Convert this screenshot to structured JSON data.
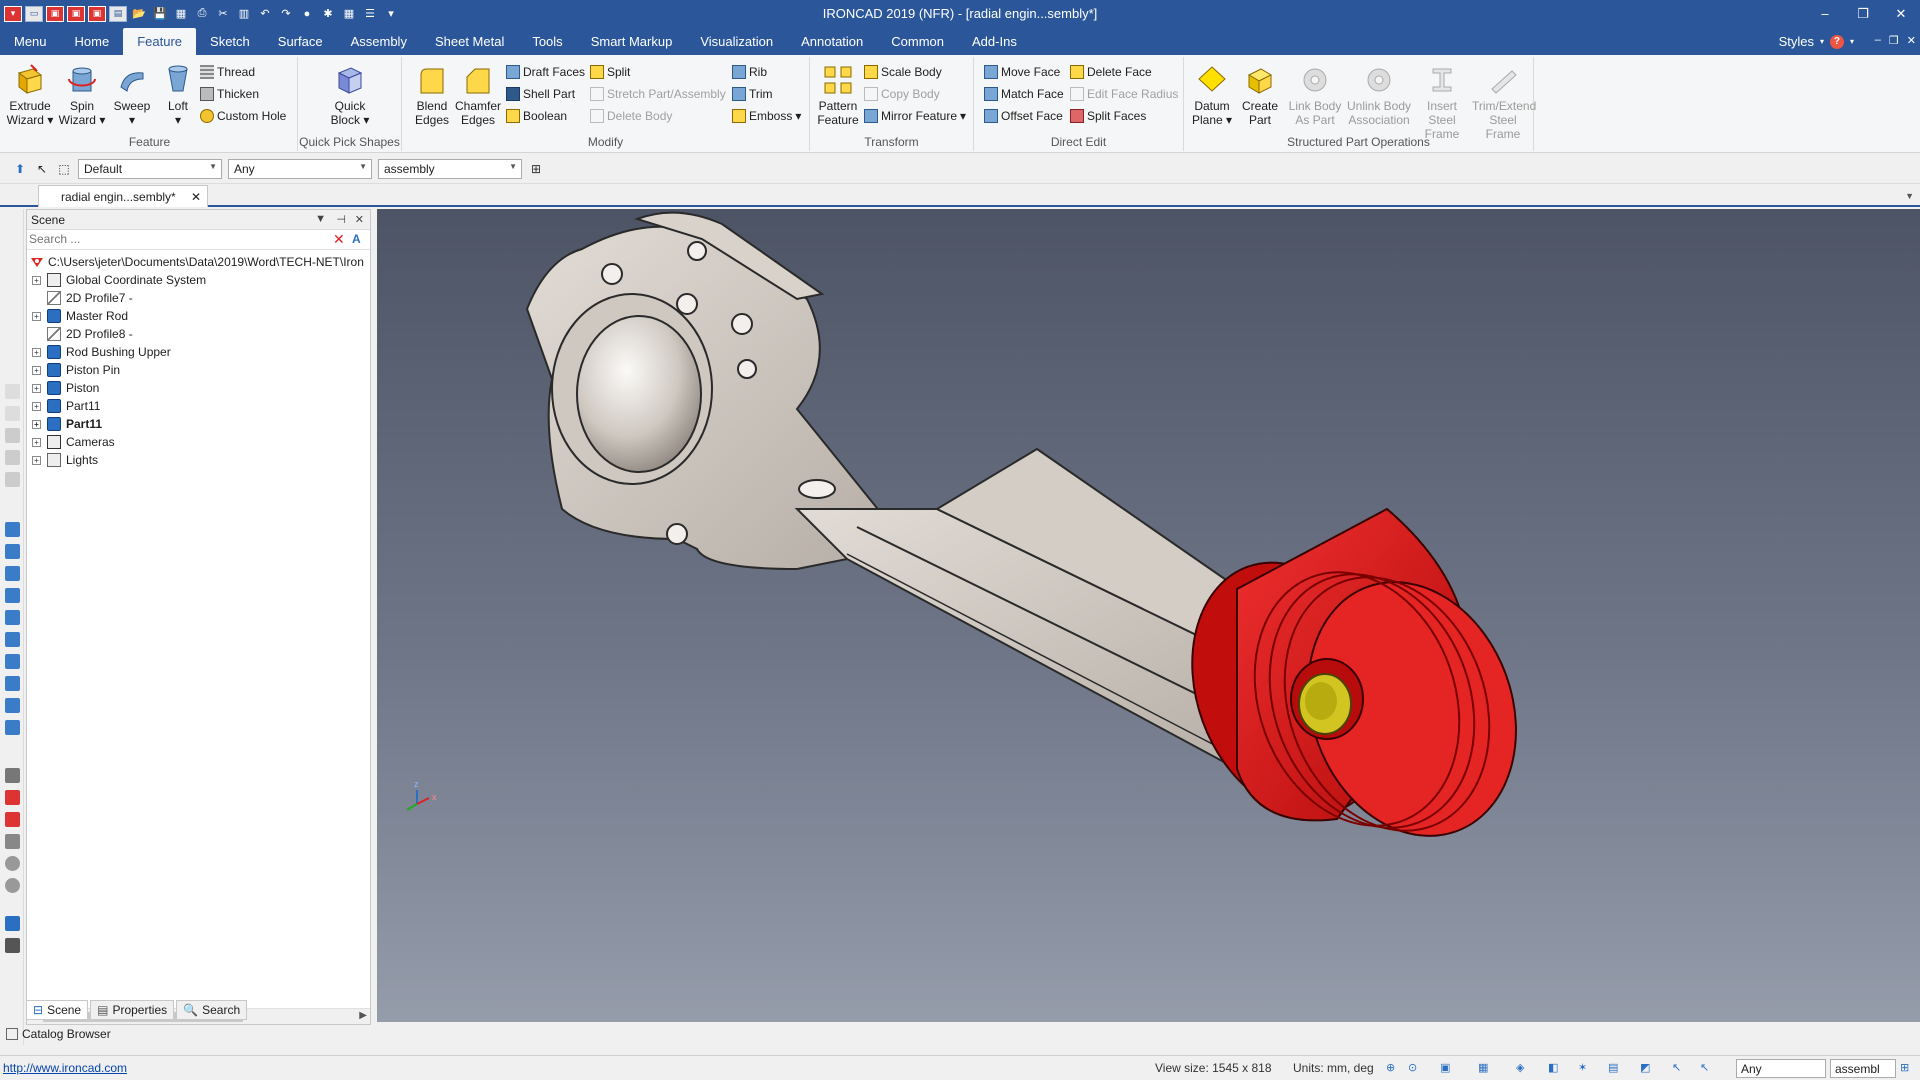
{
  "window": {
    "title": "IRONCAD 2019 (NFR) - [radial engin...sembly*]"
  },
  "ribbon_tabs": [
    "Menu",
    "Home",
    "Feature",
    "Sketch",
    "Surface",
    "Assembly",
    "Sheet Metal",
    "Tools",
    "Smart Markup",
    "Visualization",
    "Annotation",
    "Common",
    "Add-Ins"
  ],
  "active_tab": "Feature",
  "styles_label": "Styles",
  "groups": {
    "feature": {
      "label": "Feature",
      "extrude_wizard": "Extrude Wizard",
      "spin_wizard": "Spin Wizard",
      "sweep": "Sweep",
      "loft": "Loft",
      "thread": "Thread",
      "thicken": "Thicken",
      "custom_hole": "Custom Hole"
    },
    "quick_pick": {
      "label": "Quick Pick Shapes",
      "quick_block": "Quick Block"
    },
    "modify": {
      "label": "Modify",
      "blend_edges": "Blend Edges",
      "chamfer_edges": "Chamfer Edges",
      "draft_faces": "Draft Faces",
      "shell_part": "Shell Part",
      "boolean": "Boolean",
      "split": "Split",
      "stretch": "Stretch Part/Assembly",
      "delete_body": "Delete Body",
      "rib": "Rib",
      "trim": "Trim",
      "emboss": "Emboss"
    },
    "transform": {
      "label": "Transform",
      "pattern_feature": "Pattern Feature",
      "scale_body": "Scale Body",
      "copy_body": "Copy Body",
      "mirror_feature": "Mirror Feature"
    },
    "direct_edit": {
      "label": "Direct Edit",
      "move_face": "Move Face",
      "match_face": "Match Face",
      "offset_face": "Offset Face",
      "delete_face": "Delete Face",
      "edit_face_radius": "Edit Face Radius",
      "split_faces": "Split Faces"
    },
    "structured": {
      "label": "Structured Part Operations",
      "datum_plane": "Datum Plane",
      "create_part": "Create Part",
      "link_body": "Link Body As Part",
      "unlink_body": "Unlink Body Association",
      "insert_steel": "Insert Steel Frame",
      "trim_steel": "Trim/Extend Steel Frame"
    }
  },
  "toolbar": {
    "style_combo": "Default",
    "filter_combo": "Any",
    "scope_combo": "assembly"
  },
  "doc_tab": "radial engin...sembly*",
  "scene": {
    "title": "Scene",
    "search_placeholder": "Search ...",
    "root_path": "C:\\Users\\jeter\\Documents\\Data\\2019\\Word\\TECH-NET\\Iron",
    "items": [
      {
        "label": "Global Coordinate System",
        "expandable": true,
        "icon": "coordinate-system-icon",
        "bold": false
      },
      {
        "label": "2D Profile7 -",
        "expandable": false,
        "icon": "profile-icon",
        "bold": false
      },
      {
        "label": "Master Rod",
        "expandable": true,
        "icon": "part-icon",
        "bold": false
      },
      {
        "label": "2D Profile8 -",
        "expandable": false,
        "icon": "profile-icon",
        "bold": false
      },
      {
        "label": "Rod Bushing Upper",
        "expandable": true,
        "icon": "part-icon",
        "bold": false
      },
      {
        "label": "Piston Pin",
        "expandable": true,
        "icon": "part-icon",
        "bold": false
      },
      {
        "label": "Piston",
        "expandable": true,
        "icon": "part-icon",
        "bold": false
      },
      {
        "label": "Part11",
        "expandable": true,
        "icon": "part-icon",
        "bold": false
      },
      {
        "label": "Part11",
        "expandable": true,
        "icon": "part-icon",
        "bold": true
      },
      {
        "label": "Cameras",
        "expandable": true,
        "icon": "camera-icon",
        "bold": false
      },
      {
        "label": "Lights",
        "expandable": true,
        "icon": "light-icon",
        "bold": false
      }
    ],
    "tabs": [
      "Scene",
      "Properties",
      "Search"
    ],
    "catalog_browser": "Catalog Browser"
  },
  "statusbar": {
    "link": "http://www.ironcad.com",
    "view_size": "View size: 1545 x  818",
    "units": "Units: mm, deg",
    "filter": "Any",
    "scope": "assembl"
  },
  "colors": {
    "accent": "#2b579a",
    "piston": "#d21010",
    "rod": "#c9c2bb"
  }
}
